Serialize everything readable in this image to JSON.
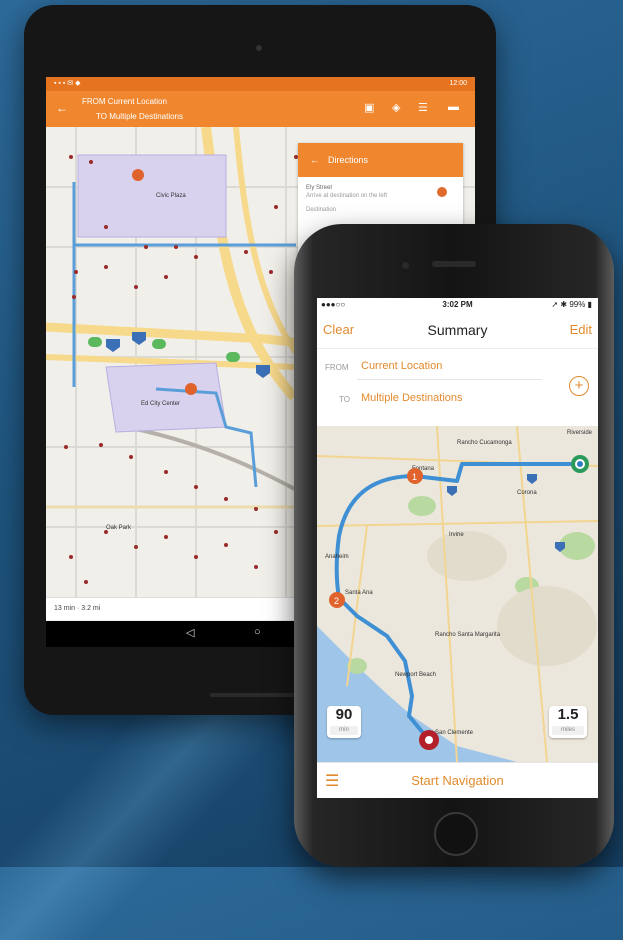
{
  "tablet": {
    "status_time": "12:00",
    "appbar": {
      "from_label": "FROM Current Location",
      "to_label": "TO Multiple Destinations"
    },
    "panel": {
      "title": "Directions",
      "row1": "Ely Street",
      "row2": "Arrive at destination on the left",
      "row3": "Destination"
    },
    "map_labels": [
      "Civic Plaza",
      "Ed City Center",
      "Oak Park"
    ],
    "footer": "13 min · 3.2 mi"
  },
  "phone": {
    "status": {
      "carrier": "●●●○○",
      "time": "3:02 PM",
      "battery": "99%"
    },
    "nav": {
      "clear_label": "Clear",
      "title": "Summary",
      "edit_label": "Edit"
    },
    "route": {
      "from_label": "FROM",
      "from_value": "Current Location",
      "to_label": "TO",
      "to_value": "Multiple Destinations"
    },
    "map": {
      "labels": [
        "Rancho Cucamonga",
        "Fontana",
        "Anaheim",
        "Santa Ana",
        "Irvine",
        "Rancho Santa Margarita",
        "Newport Beach",
        "San Clemente",
        "Riverside",
        "Corona"
      ],
      "stop_1": "1",
      "stop_2": "2"
    },
    "time_badge": {
      "value": "90",
      "unit": "min"
    },
    "distance_badge": {
      "value": "1.5",
      "unit": "miles"
    },
    "toolbar": {
      "start_label": "Start Navigation"
    }
  },
  "colors": {
    "accent": "#f0872f",
    "route_blue": "#3e8fd4",
    "stop_orange": "#e0622c",
    "origin_green": "#2b9a5a"
  }
}
